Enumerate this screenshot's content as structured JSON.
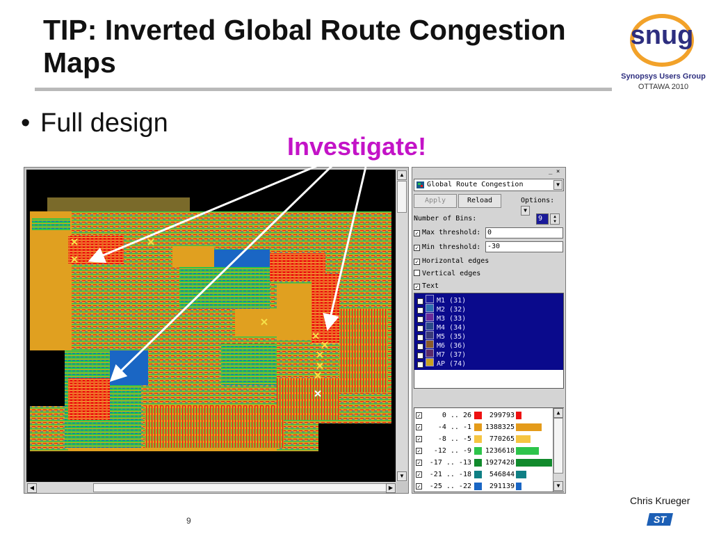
{
  "slide": {
    "title": "TIP: Inverted Global Route Congestion Maps",
    "bullet": "Full design",
    "callout": "Investigate!",
    "author": "Chris Krueger",
    "page_number": "9"
  },
  "logo": {
    "brand": "snug",
    "subtitle": "Synopsys Users Group",
    "location": "OTTAWA 2010",
    "company": "ST"
  },
  "panel": {
    "map_type": "Global Route Congestion",
    "apply_label": "Apply",
    "reload_label": "Reload",
    "options_label": "Options:",
    "num_bins_label": "Number of Bins:",
    "num_bins_value": "9",
    "max_threshold_label": "Max threshold:",
    "max_threshold_value": "0",
    "min_threshold_label": "Min threshold:",
    "min_threshold_value": "-30",
    "horizontal_edges_label": "Horizontal edges",
    "vertical_edges_label": "Vertical edges",
    "text_label": "Text",
    "checks": {
      "max_threshold": true,
      "min_threshold": true,
      "horizontal_edges": true,
      "vertical_edges": false,
      "text": true
    },
    "layers": [
      {
        "label": "M1 (31)",
        "color": "#1a1a9a"
      },
      {
        "label": "M2 (32)",
        "color": "#2f6fb0"
      },
      {
        "label": "M3 (33)",
        "color": "#6a2a9a"
      },
      {
        "label": "M4 (34)",
        "color": "#2a4a8a"
      },
      {
        "label": "M5 (35)",
        "color": "#3a3a7a"
      },
      {
        "label": "M6 (36)",
        "color": "#8a5a2a"
      },
      {
        "label": "M7 (37)",
        "color": "#5a2a6a"
      },
      {
        "label": "AP (74)",
        "color": "#c8a020"
      }
    ],
    "bins": [
      {
        "range": "0 .. 26",
        "count": "299793",
        "color": "#ee1111",
        "fraction": 0.16
      },
      {
        "range": "-4 .. -1",
        "count": "1388325",
        "color": "#e49b1a",
        "fraction": 0.72
      },
      {
        "range": "-8 .. -5",
        "count": "770265",
        "color": "#f5c542",
        "fraction": 0.4
      },
      {
        "range": "-12 .. -9",
        "count": "1236618",
        "color": "#2dc44a",
        "fraction": 0.64
      },
      {
        "range": "-17 .. -13",
        "count": "1927428",
        "color": "#118a2c",
        "fraction": 1.0
      },
      {
        "range": "-21 .. -18",
        "count": "546844",
        "color": "#0f7f84",
        "fraction": 0.28
      },
      {
        "range": "-25 .. -22",
        "count": "291139",
        "color": "#1a66c4",
        "fraction": 0.15
      }
    ]
  }
}
